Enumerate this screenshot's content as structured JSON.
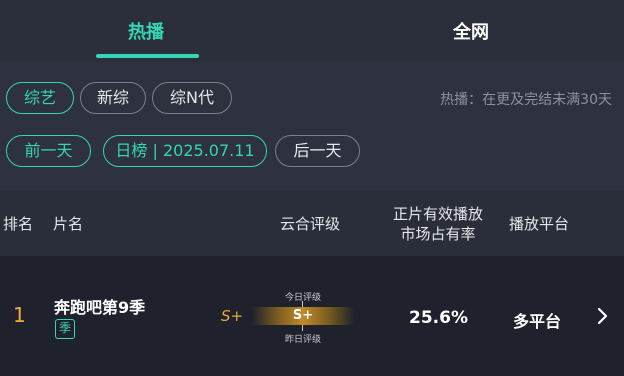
{
  "tabs": {
    "hot": "热播",
    "all": "全网"
  },
  "filters": {
    "categories": [
      "综艺",
      "新综",
      "综N代"
    ],
    "hint": "热播：在更及完结未满30天",
    "prev_day": "前一天",
    "date_label": "日榜 | 2025.07.11",
    "next_day": "后一天"
  },
  "table": {
    "headers": {
      "rank": "排名",
      "title": "片名",
      "rating": "云合评级",
      "share_line1": "正片有效播放",
      "share_line2": "市场占有率",
      "platform": "播放平台"
    },
    "rows": [
      {
        "rank": "1",
        "title": "奔跑吧第9季",
        "tag": "季",
        "prev_grade": "S+",
        "grade": "S+",
        "today_label": "今日评级",
        "yesterday_label": "昨日评级",
        "share": "25.6%",
        "platform": "多平台"
      }
    ]
  },
  "colors": {
    "accent": "#35d6b4",
    "rank": "#f1ad36",
    "grade": "#e8a93a"
  },
  "icons": {
    "row_chevron": "chevron-right-icon"
  }
}
